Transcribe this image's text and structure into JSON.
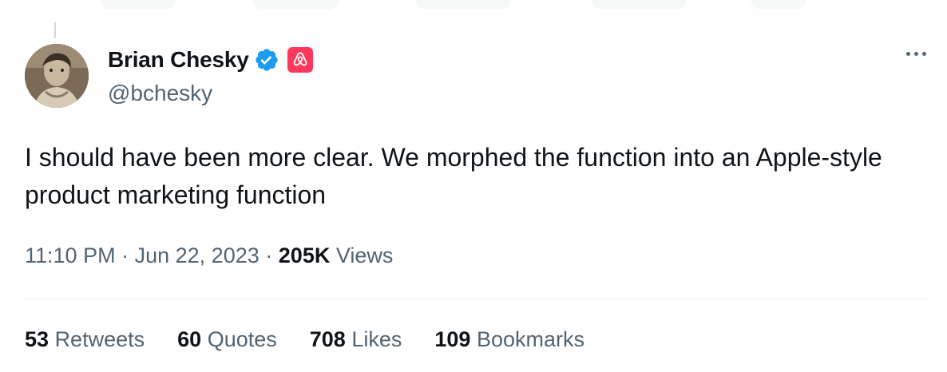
{
  "author": {
    "name": "Brian Chesky",
    "handle": "@bchesky",
    "verified_icon": "verified-badge-icon",
    "affiliation_icon": "airbnb-logo-icon",
    "colors": {
      "verified": "#1d9bf0",
      "affiliation": "#ff385c"
    }
  },
  "tweet": {
    "text": "I should have been more clear. We morphed the function into an Apple-style product marketing function",
    "time": "11:10 PM",
    "date": "Jun 22, 2023",
    "separator": "·",
    "views_count": "205K",
    "views_label": "Views"
  },
  "stats": [
    {
      "count": "53",
      "label": "Retweets"
    },
    {
      "count": "60",
      "label": "Quotes"
    },
    {
      "count": "708",
      "label": "Likes"
    },
    {
      "count": "109",
      "label": "Bookmarks"
    }
  ],
  "more_icon": "more-options-icon"
}
